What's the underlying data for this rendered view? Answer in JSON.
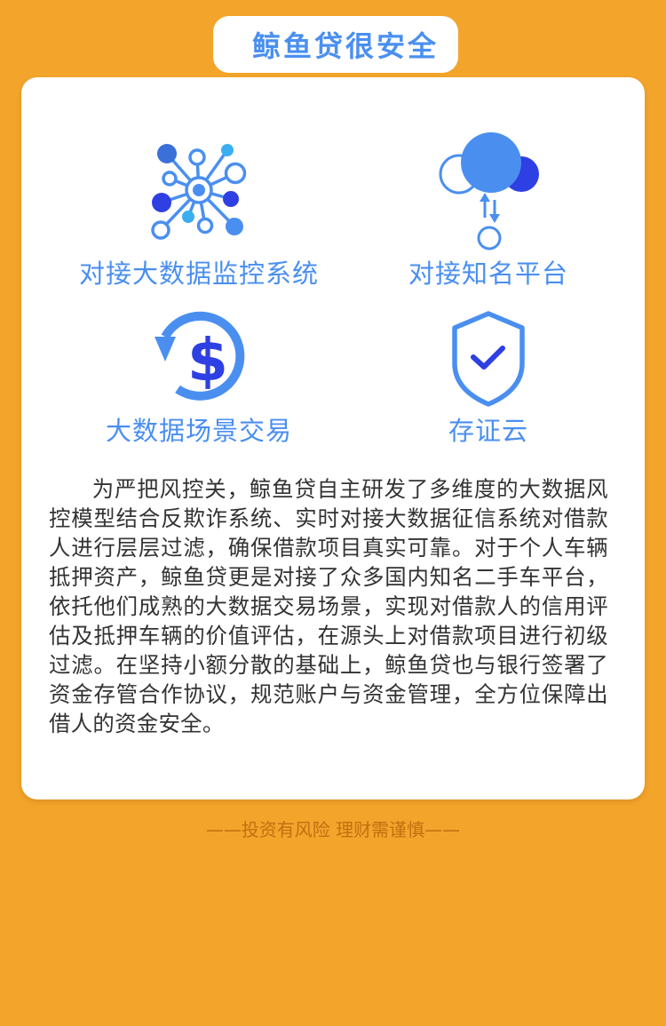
{
  "header": {
    "title": "鲸鱼贷很安全"
  },
  "features": [
    {
      "label": "对接大数据监控系统",
      "icon": "network-icon"
    },
    {
      "label": "对接知名平台",
      "icon": "cloud-sync-icon"
    },
    {
      "label": "大数据场景交易",
      "icon": "dollar-cycle-icon"
    },
    {
      "label": "存证云",
      "icon": "shield-check-icon"
    }
  ],
  "description": "为严把风控关，鲸鱼贷自主研发了多维度的大数据风控模型结合反欺诈系统、实时对接大数据征信系统对借款人进行层层过滤，确保借款项目真实可靠。对于个人车辆抵押资产，鲸鱼贷更是对接了众多国内知名二手车平台，依托他们成熟的大数据交易场景，实现对借款人的信用评估及抵押车辆的价值评估，在源头上对借款项目进行初级过滤。在坚持小额分散的基础上，鲸鱼贷也与银行签署了资金存管合作协议，规范账户与资金管理，全方位保障出借人的资金安全。",
  "footer": {
    "disclaimer": "——投资有风险  理财需谨慎——"
  },
  "colors": {
    "background": "#f3a42b",
    "accent": "#4a8ff0",
    "accent_dark": "#2e3fe3",
    "accent_light": "#3aaef0"
  }
}
